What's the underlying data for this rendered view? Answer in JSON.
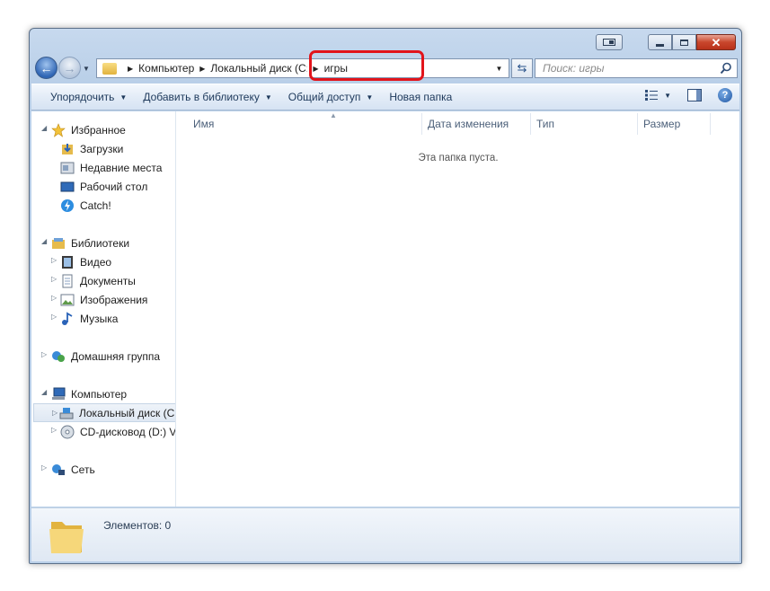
{
  "window": {
    "caption_buttons": {
      "snap_icon": "window-snap-icon",
      "minimize_icon": "minimize-icon",
      "maximize_icon": "maximize-icon",
      "close_icon": "close-icon"
    }
  },
  "address_bar": {
    "crumbs": [
      "Компьютер",
      "Локальный диск (C:)",
      "игры"
    ],
    "refresh_icon": "refresh-icon"
  },
  "search": {
    "placeholder": "Поиск: игры"
  },
  "toolbar": {
    "organize": "Упорядочить",
    "add_to_library": "Добавить в библиотеку",
    "share": "Общий доступ",
    "new_folder": "Новая папка"
  },
  "navigation": {
    "favorites": {
      "label": "Избранное",
      "items": [
        "Загрузки",
        "Недавние места",
        "Рабочий стол",
        "Catch!"
      ]
    },
    "libraries": {
      "label": "Библиотеки",
      "items": [
        "Видео",
        "Документы",
        "Изображения",
        "Музыка"
      ]
    },
    "homegroup": {
      "label": "Домашняя группа"
    },
    "computer": {
      "label": "Компьютер",
      "items": [
        "Локальный диск (C:)",
        "CD-дисковод (D:) Vi"
      ]
    },
    "network": {
      "label": "Сеть"
    }
  },
  "columns": [
    "Имя",
    "Дата изменения",
    "Тип",
    "Размер"
  ],
  "empty_message": "Эта папка пуста.",
  "details": {
    "items_count": "Элементов: 0"
  },
  "colors": {
    "highlight": "#e2141b",
    "accent": "#1e395b"
  }
}
